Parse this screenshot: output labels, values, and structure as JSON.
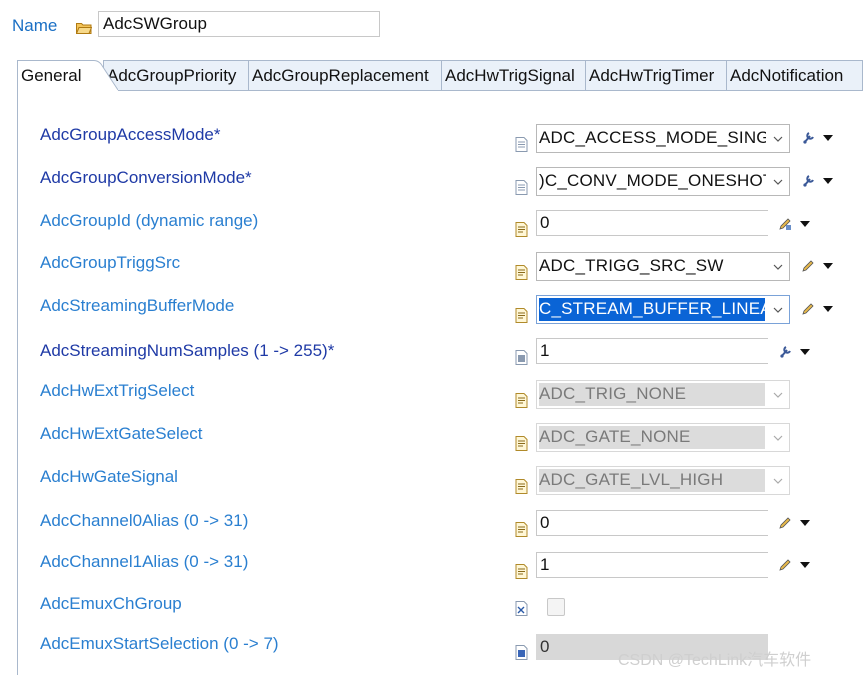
{
  "name_row": {
    "label": "Name",
    "value": "AdcSWGroup",
    "icon": "folder-icon"
  },
  "tabs": [
    {
      "label": "General",
      "active": true
    },
    {
      "label": "AdcGroupPriority",
      "active": false
    },
    {
      "label": "AdcGroupReplacement",
      "active": false
    },
    {
      "label": "AdcHwTrigSignal",
      "active": false
    },
    {
      "label": "AdcHwTrigTimer",
      "active": false
    },
    {
      "label": "AdcNotification",
      "active": false
    }
  ],
  "rows": [
    {
      "label": "AdcGroupAccessMode*",
      "required": true,
      "control": "combo",
      "value": "ADC_ACCESS_MODE_SINGLE",
      "action_icon": "wrench-icon"
    },
    {
      "label": "AdcGroupConversionMode*",
      "required": true,
      "control": "combo",
      "value": ")C_CONV_MODE_ONESHOT",
      "action_icon": "wrench-icon"
    },
    {
      "label": "AdcGroupId (dynamic range)",
      "required": false,
      "control": "text",
      "value": "0",
      "action_icon": "pencil-calc-icon"
    },
    {
      "label": "AdcGroupTriggSrc",
      "required": false,
      "control": "combo",
      "value": "ADC_TRIGG_SRC_SW",
      "action_icon": "pencil-icon"
    },
    {
      "label": "AdcStreamingBufferMode",
      "required": false,
      "control": "combo-selected",
      "value": "C_STREAM_BUFFER_LINEAR",
      "action_icon": "pencil-icon"
    },
    {
      "label": "AdcStreamingNumSamples (1 -> 255)*",
      "required": true,
      "control": "text",
      "value": "1",
      "action_icon": "wrench-icon"
    },
    {
      "label": "AdcHwExtTrigSelect",
      "required": false,
      "control": "combo-disabled",
      "value": "ADC_TRIG_NONE",
      "action_icon": ""
    },
    {
      "label": "AdcHwExtGateSelect",
      "required": false,
      "control": "combo-disabled",
      "value": "ADC_GATE_NONE",
      "action_icon": ""
    },
    {
      "label": "AdcHwGateSignal",
      "required": false,
      "control": "combo-disabled",
      "value": "ADC_GATE_LVL_HIGH",
      "action_icon": ""
    },
    {
      "label": "AdcChannel0Alias (0 -> 31)",
      "required": false,
      "control": "text",
      "value": "0",
      "action_icon": "pencil-icon"
    },
    {
      "label": "AdcChannel1Alias (0 -> 31)",
      "required": false,
      "control": "text",
      "value": "1",
      "action_icon": "pencil-icon"
    },
    {
      "label": "AdcEmuxChGroup",
      "required": false,
      "control": "checkbox",
      "value": "",
      "action_icon": ""
    },
    {
      "label": "AdcEmuxStartSelection (0 -> 7)",
      "required": false,
      "control": "text-disabled",
      "value": "0",
      "action_icon": ""
    }
  ],
  "watermark": "CSDN @TechLink汽车软件",
  "colors": {
    "required_label": "#1f3aa6",
    "optional_label": "#2a7fd0",
    "selection": "#0a64d6",
    "tab_bg": "#eaf1f9"
  }
}
